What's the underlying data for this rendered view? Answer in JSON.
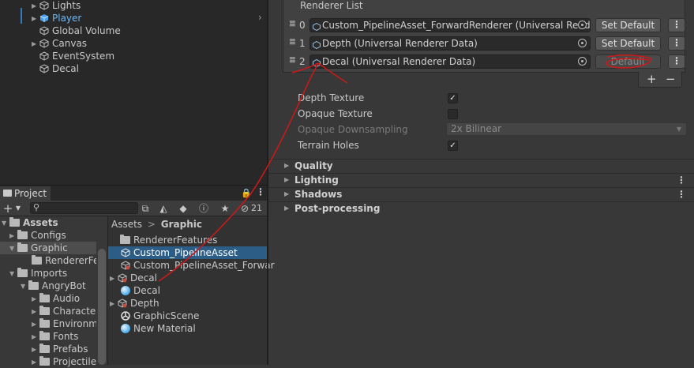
{
  "hierarchy": {
    "items": [
      {
        "label": "Lights",
        "expanded": false,
        "selected": false
      },
      {
        "label": "Player",
        "expanded": false,
        "selected": true
      },
      {
        "label": "Global Volume"
      },
      {
        "label": "Canvas",
        "expanded": false
      },
      {
        "label": "EventSystem"
      },
      {
        "label": "Decal"
      }
    ]
  },
  "inspector": {
    "renderer_list_title": "Renderer List",
    "renderers": [
      {
        "index": "0",
        "value": "Custom_PipelineAsset_ForwardRenderer (Universal Rendere",
        "button": "Set Default"
      },
      {
        "index": "1",
        "value": "Depth (Universal Renderer Data)",
        "button": "Set Default"
      },
      {
        "index": "2",
        "value": "Decal (Universal Renderer Data)",
        "button": "Default"
      }
    ],
    "more_label": "⋮",
    "plus_label": "+",
    "minus_label": "−",
    "properties": {
      "depth_texture": {
        "label": "Depth Texture",
        "checked": true
      },
      "opaque_texture": {
        "label": "Opaque Texture",
        "checked": false
      },
      "opaque_downsampling": {
        "label": "Opaque Downsampling",
        "value": "2x Bilinear"
      },
      "terrain_holes": {
        "label": "Terrain Holes",
        "checked": true
      }
    },
    "sections": [
      {
        "label": "Quality",
        "more": ""
      },
      {
        "label": "Lighting",
        "more": "⋮"
      },
      {
        "label": "Shadows",
        "more": "⋮"
      },
      {
        "label": "Post-processing",
        "more": ""
      }
    ]
  },
  "project": {
    "tab_label": "Project",
    "hidden_count": "21",
    "breadcrumb_root": "Assets",
    "breadcrumb_sep": ">",
    "breadcrumb_current": "Graphic",
    "tree": [
      {
        "label": "Assets"
      },
      {
        "label": "Configs"
      },
      {
        "label": "Graphic"
      },
      {
        "label": "RendererFe"
      },
      {
        "label": "Imports"
      },
      {
        "label": "AngryBot"
      },
      {
        "label": "Audio"
      },
      {
        "label": "Characte"
      },
      {
        "label": "Environm"
      },
      {
        "label": "Fonts"
      },
      {
        "label": "Prefabs"
      },
      {
        "label": "Projectile"
      }
    ],
    "files": [
      {
        "label": "RendererFeatures",
        "icon": "folder-icon"
      },
      {
        "label": "Custom_PipelineAsset",
        "icon": "pipeline-asset-icon"
      },
      {
        "label": "Custom_PipelineAsset_Forwar",
        "icon": "renderer-data-icon"
      },
      {
        "label": "Decal",
        "icon": "renderer-data-icon"
      },
      {
        "label": "Decal",
        "icon": "material-sphere-icon"
      },
      {
        "label": "Depth",
        "icon": "renderer-data-icon"
      },
      {
        "label": "GraphicScene",
        "icon": "unity-scene-icon"
      },
      {
        "label": "New Material",
        "icon": "material-sphere-icon"
      }
    ]
  },
  "colors": {
    "selection_blue": "#2c5d87",
    "annotation_red": "#d01818",
    "player_text_blue": "#6fb6f0"
  }
}
